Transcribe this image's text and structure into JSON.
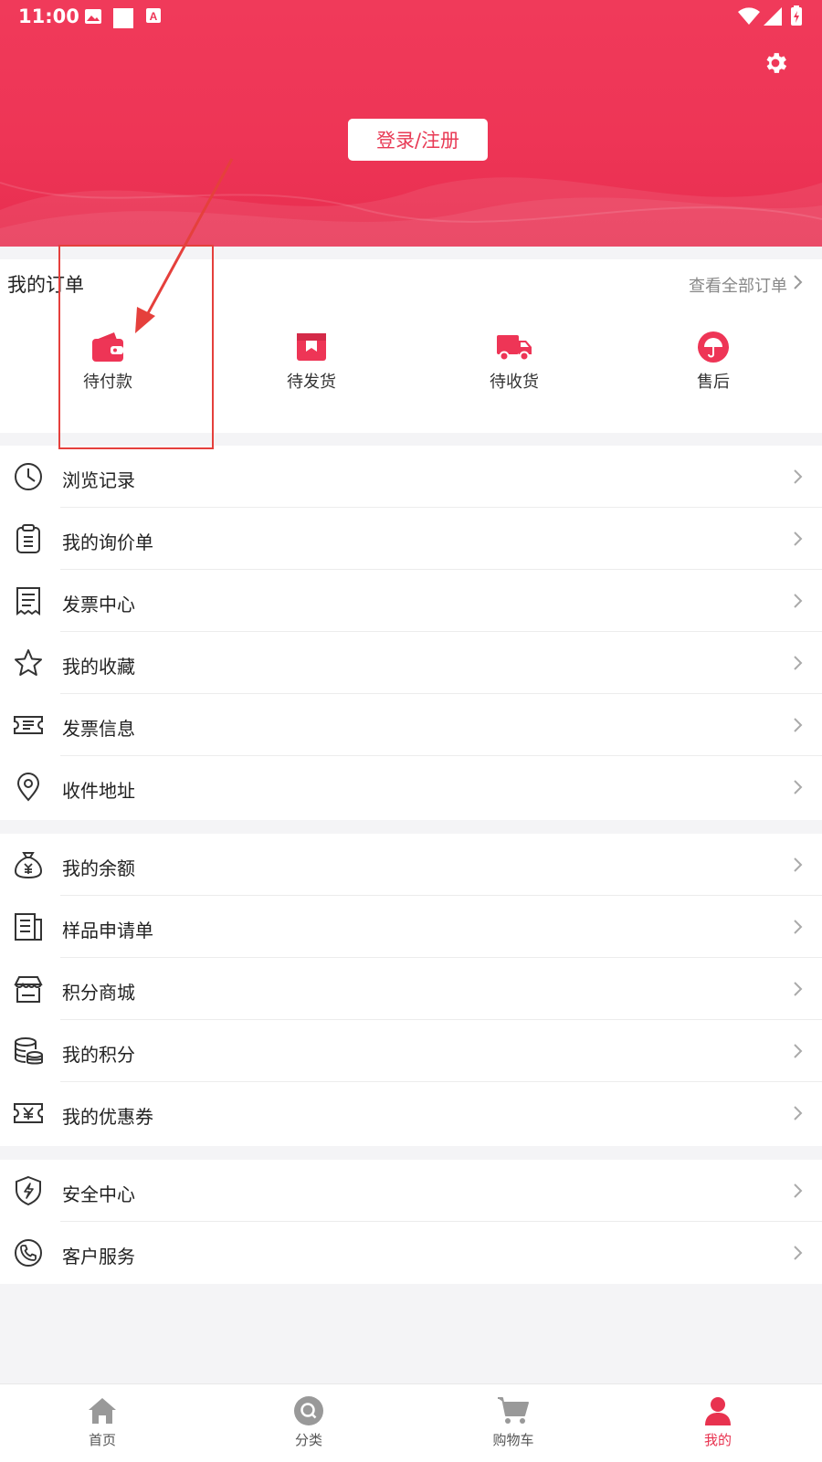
{
  "status_bar": {
    "time": "11:00"
  },
  "header": {
    "login_label": "登录/注册"
  },
  "orders": {
    "title": "我的订单",
    "view_all": "查看全部订单",
    "items": [
      {
        "label": "待付款",
        "icon": "wallet-icon"
      },
      {
        "label": "待发货",
        "icon": "package-icon"
      },
      {
        "label": "待收货",
        "icon": "truck-icon"
      },
      {
        "label": "售后",
        "icon": "umbrella-icon"
      }
    ]
  },
  "menu_group1": [
    {
      "label": "浏览记录",
      "icon": "clock-icon"
    },
    {
      "label": "我的询价单",
      "icon": "clipboard-icon"
    },
    {
      "label": "发票中心",
      "icon": "receipt-icon"
    },
    {
      "label": "我的收藏",
      "icon": "star-icon"
    },
    {
      "label": "发票信息",
      "icon": "ticket-icon"
    },
    {
      "label": "收件地址",
      "icon": "location-pin-icon"
    }
  ],
  "menu_group2": [
    {
      "label": "我的余额",
      "icon": "money-bag-icon"
    },
    {
      "label": "样品申请单",
      "icon": "document-icon"
    },
    {
      "label": "积分商城",
      "icon": "store-icon"
    },
    {
      "label": "我的积分",
      "icon": "coins-icon"
    },
    {
      "label": "我的优惠券",
      "icon": "coupon-icon"
    }
  ],
  "menu_group3": [
    {
      "label": "安全中心",
      "icon": "shield-icon"
    },
    {
      "label": "客户服务",
      "icon": "phone-icon"
    }
  ],
  "tabbar": [
    {
      "label": "首页",
      "icon": "home-icon"
    },
    {
      "label": "分类",
      "icon": "search-icon"
    },
    {
      "label": "购物车",
      "icon": "cart-icon"
    },
    {
      "label": "我的",
      "icon": "user-icon",
      "active": true
    }
  ],
  "colors": {
    "brand": "#ee3556",
    "accent_text": "#e83a55",
    "annotation": "#e5403c"
  }
}
